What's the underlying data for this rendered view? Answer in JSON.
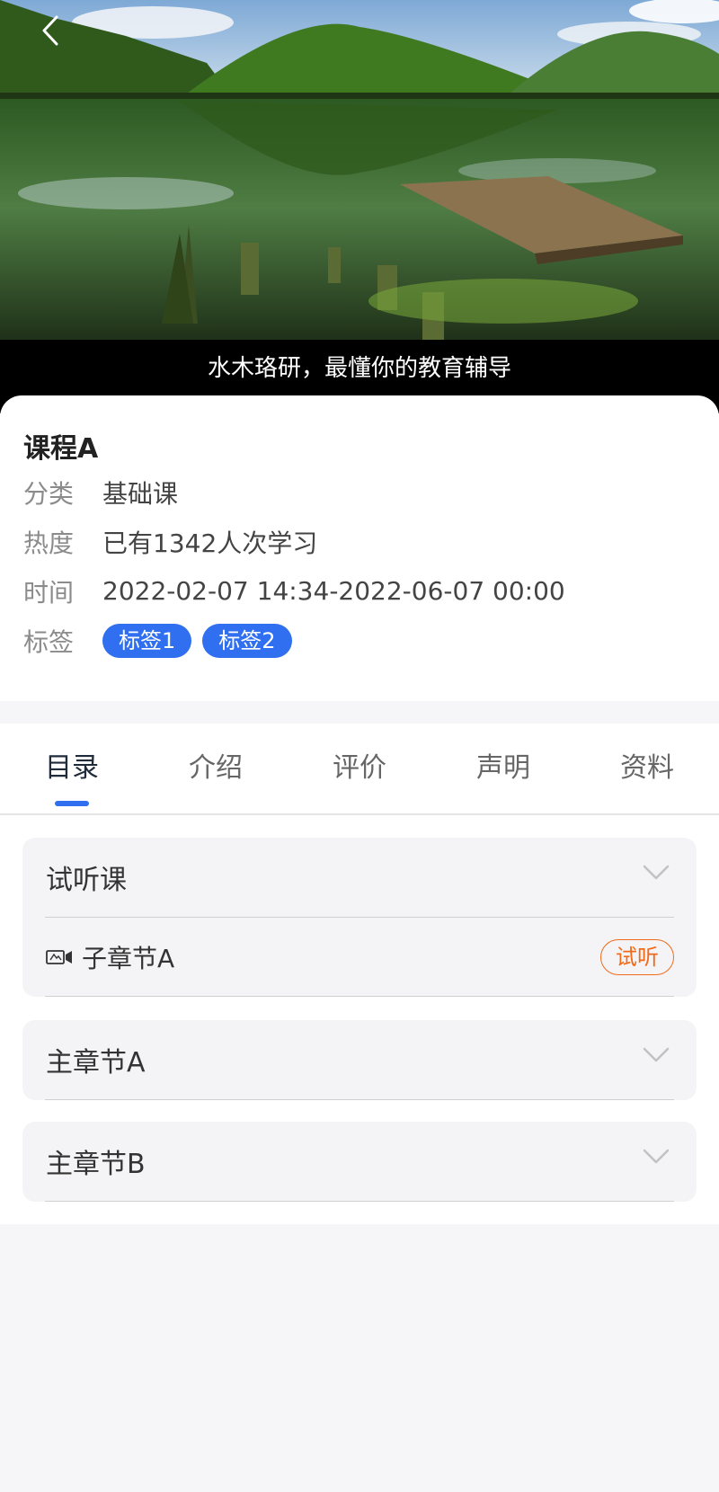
{
  "hero": {
    "caption": "水木珞研，最懂你的教育辅导"
  },
  "course": {
    "title": "课程A",
    "rows": [
      {
        "label": "分类",
        "value": "基础课"
      },
      {
        "label": "热度",
        "value": "已有1342人次学习"
      },
      {
        "label": "时间",
        "value": "2022-02-07 14:34-2022-06-07 00:00"
      }
    ],
    "tags_label": "标签",
    "tags": [
      "标签1",
      "标签2"
    ]
  },
  "tabs": [
    {
      "label": "目录",
      "active": true
    },
    {
      "label": "介绍",
      "active": false
    },
    {
      "label": "评价",
      "active": false
    },
    {
      "label": "声明",
      "active": false
    },
    {
      "label": "资料",
      "active": false
    }
  ],
  "catalog": {
    "sections": [
      {
        "title": "试听课",
        "expanded": true,
        "children": [
          {
            "title": "子章节A",
            "icon": "video-icon",
            "badge": "试听"
          }
        ]
      },
      {
        "title": "主章节A",
        "expanded": false,
        "children": []
      },
      {
        "title": "主章节B",
        "expanded": false,
        "children": []
      }
    ]
  },
  "colors": {
    "accent": "#2f6ff0",
    "trial": "#f06a1a",
    "background": "#f6f6f8"
  }
}
